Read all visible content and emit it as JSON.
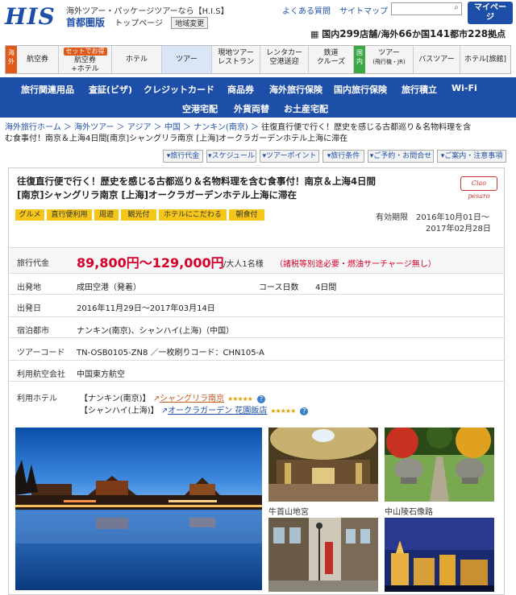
{
  "header": {
    "logo": "HIS",
    "tagline": "海外ツアー・パッケージツアーなら【H.I.S】",
    "region": "首都圏版",
    "top_link": "トップページ",
    "region_change": "地域変更",
    "faq": "よくある質問",
    "sitemap": "サイトマップ",
    "mypage_line1": "マイペー",
    "mypage_line2": "ジ",
    "stores_prefix": "国内",
    "stores_domestic": "299",
    "stores_mid": "店舗/海外",
    "stores_countries": "66",
    "stores_mid2": "か国",
    "stores_cities": "141",
    "stores_mid3": "都市",
    "stores_total": "228",
    "stores_suffix": "拠点"
  },
  "nav": {
    "overseas_tag": "海外",
    "domestic_tag": "国内",
    "items": [
      {
        "l1": "航空券",
        "l2": ""
      },
      {
        "badge": "セットでお得",
        "l1": "航空券",
        "l2": "+ホテル"
      },
      {
        "l1": "ホテル",
        "l2": ""
      },
      {
        "l1": "ツアー",
        "l2": ""
      },
      {
        "l1": "現地ツアー",
        "l2": "レストラン"
      },
      {
        "l1": "レンタカー",
        "l2": "空港送迎"
      },
      {
        "l1": "鉄道",
        "l2": "クルーズ"
      },
      {
        "l1": "ツアー",
        "l2": "(飛行機・JR)"
      },
      {
        "l1": "バスツアー",
        "l2": ""
      },
      {
        "l1": "ホテル[旅館]",
        "l2": ""
      }
    ]
  },
  "subnav": {
    "items": [
      "旅行関連用品",
      "査証(ビザ)",
      "クレジットカード",
      "商品券",
      "海外旅行保険",
      "国内旅行保険",
      "旅行積立",
      "Wi-Fi",
      "空港宅配",
      "外貨両替",
      "お土産宅配"
    ]
  },
  "breadcrumb": {
    "items": [
      "海外旅行ホーム",
      "海外ツアー",
      "アジア",
      "中国",
      "ナンキン(南京)"
    ],
    "separator": "＞",
    "current_l1": "往復直行便で行く！歴史を感じる古都巡り＆名物料理を含",
    "current_l2": "む食事付！南京＆上海4日間[南京]シャングリラ南京 [上海]オークラガーデンホテル上海に滞在"
  },
  "tabs": [
    "▾旅行代金",
    "▾スケジュール",
    "▾ツアーポイント",
    "▾旅行条件",
    "▾ご予約・お問合せ",
    "▾ご案内・注意事項"
  ],
  "tour": {
    "title_l1": "往復直行便で行く！歴史を感じる古都巡り＆名物料理を含む食事付！南京＆上海4日間",
    "title_l2": "[南京]シャングリラ南京 [上海]オークラガーデンホテル上海に滞在",
    "brand_stamp": "Ciao pesaro",
    "tags": [
      "グルメ",
      "直行便利用",
      "周遊",
      "観光付",
      "ホテルにこだわる",
      "朝食付"
    ],
    "valid_label": "有効期限",
    "valid_from": "2016年10月01日〜",
    "valid_to": "2017年02月28日",
    "price_label": "旅行代金",
    "price": "89,800円〜129,000円",
    "price_unit": "/大人1名様",
    "price_note": "（諸税等別途必要・燃油サーチャージ無し）",
    "departure_label": "出発地",
    "departure": "成田空港（発着）",
    "days_label": "コース日数",
    "days": "4日間",
    "date_label": "出発日",
    "date": "2016年11月29日〜2017年03月14日",
    "cities_label": "宿泊都市",
    "cities": "ナンキン(南京)、シャンハイ(上海)（中国）",
    "code_label": "ツアーコード",
    "code": "TN-OSB0105-ZN8 ／一枚刷りコード：CHN105-A",
    "airline_label": "利用航空会社",
    "airline": "中国東方航空",
    "hotel_label": "利用ホテル",
    "hotel1_city": "【ナンキン(南京)】",
    "hotel1_name": "シャングリラ南京",
    "hotel2_city": "【シャンハイ(上海)】",
    "hotel2_name": "オークラガーデン 花園飯店"
  },
  "photos": {
    "caption1": "牛首山地宮",
    "caption2": "中山陵石像路"
  }
}
